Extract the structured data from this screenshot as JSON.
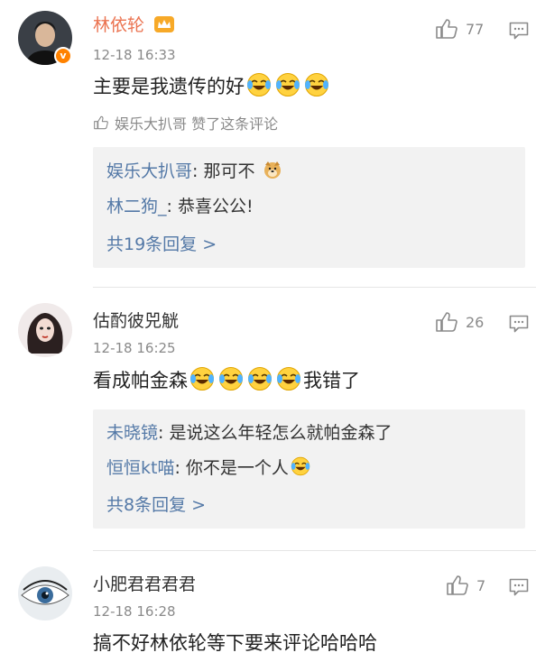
{
  "comments": [
    {
      "username": "林依轮",
      "time": "12-18 16:33",
      "likes": "77",
      "text_prefix": "主要是我遗传的好",
      "liked_by": "娱乐大扒哥 赞了这条评论",
      "replies": [
        {
          "name": "娱乐大扒哥",
          "sep": ": ",
          "text": "那可不"
        },
        {
          "name": "林二狗_",
          "sep": ": ",
          "text": "恭喜公公!"
        }
      ],
      "more": "共19条回复 >"
    },
    {
      "username": "估酌彼兕觥",
      "time": "12-18 16:25",
      "likes": "26",
      "text_prefix": "看成帕金森",
      "text_suffix": "我错了",
      "replies": [
        {
          "name": "未晓镜",
          "sep": ": ",
          "text": "是说这么年轻怎么就帕金森了"
        },
        {
          "name": "恒恒kt喵",
          "sep": ": ",
          "text": "你不是一个人"
        }
      ],
      "more": "共8条回复 >"
    },
    {
      "username": "小肥君君君君",
      "time": "12-18 16:28",
      "likes": "7",
      "text_prefix": "搞不好林依轮等下要来评论哈哈哈"
    }
  ],
  "icons": {
    "verified_badge": "v-badge-icon",
    "crown": "crown-icon",
    "laugh_cry": "laugh-cry-emoji",
    "doge": "doge-emoji",
    "thumb": "thumb-up-icon",
    "reply": "comment-icon"
  },
  "colors": {
    "username_vip": "#eb7350",
    "reply_name": "#5479a7",
    "verified": "#ff8200",
    "panel_bg": "#f2f2f2"
  }
}
